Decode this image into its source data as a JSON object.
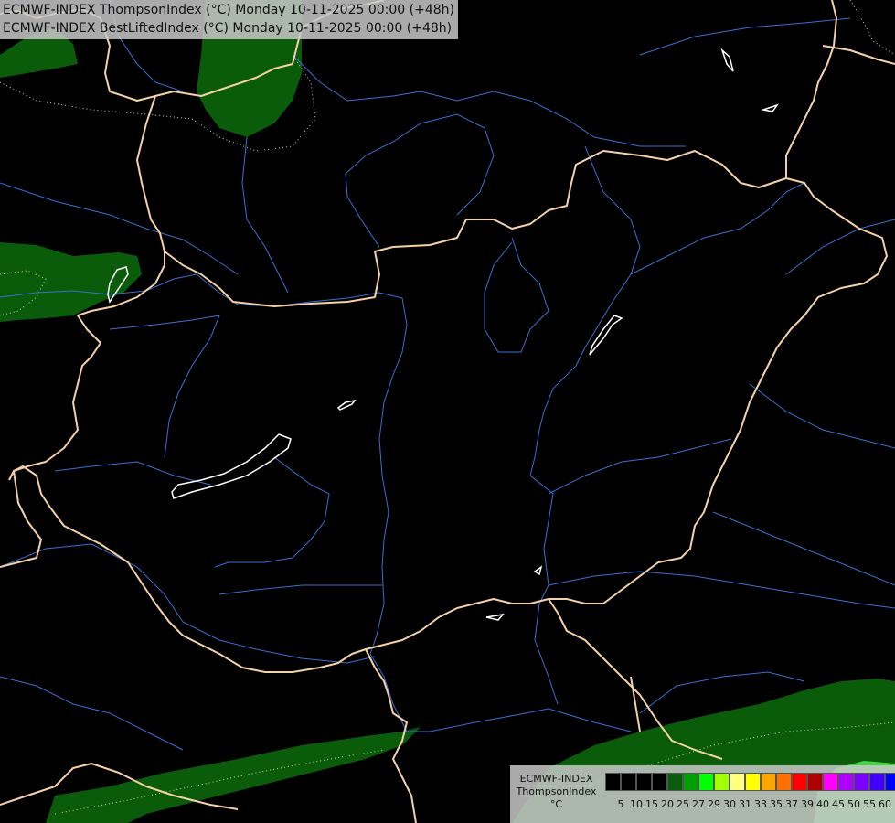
{
  "map": {
    "title_lines": [
      "ECMWF-INDEX ThompsonIndex (°C) Monday 10-11-2025 00:00 (+48h)",
      "ECMWF-INDEX BestLiftedIndex (°C) Monday 10-11-2025 00:00 (+48h)"
    ],
    "colors": {
      "background": "#000000",
      "border": "#f4d1a6",
      "river": "#3b6fd1",
      "lake": "#ffffff",
      "field_green": "#0a5c0a",
      "field_light_green": "#46d646",
      "contour": "#cfcfcf"
    }
  },
  "legend": {
    "name_lines": [
      "ECMWF-INDEX",
      "ThompsonIndex",
      "°C"
    ],
    "tick_labels": [
      "5",
      "10",
      "15",
      "20",
      "25",
      "27",
      "29",
      "30",
      "31",
      "33",
      "35",
      "37",
      "39",
      "40",
      "45",
      "50",
      "55",
      "60"
    ],
    "colors": [
      "#000000",
      "#000000",
      "#000000",
      "#000000",
      "#0b5d0b",
      "#00a000",
      "#00ff00",
      "#a0ff00",
      "#ffff80",
      "#ffff00",
      "#ffa500",
      "#ff7000",
      "#ff0000",
      "#b00000",
      "#ff00ff",
      "#b000ff",
      "#7a00ff",
      "#4000ff",
      "#0000ff"
    ]
  }
}
